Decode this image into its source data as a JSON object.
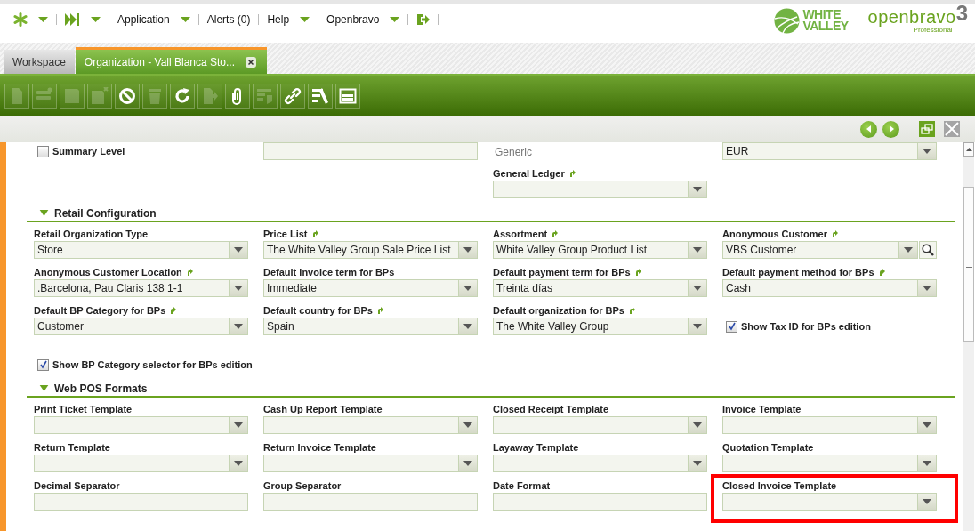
{
  "menu": [
    {
      "kind": "star",
      "caret": true
    },
    {
      "kind": "skip",
      "caret": true
    },
    {
      "kind": "text",
      "label": "Application",
      "caret": true
    },
    {
      "kind": "text",
      "label": "Alerts (0)",
      "caret": false
    },
    {
      "kind": "text",
      "label": "Help",
      "caret": true
    },
    {
      "kind": "text",
      "label": "Openbravo",
      "caret": true
    },
    {
      "kind": "logout",
      "caret": false
    }
  ],
  "logos": {
    "partner_line1": "WHITE",
    "partner_line2": "VALLEY",
    "product": "openbravo",
    "edition": "Professional",
    "version": "3"
  },
  "tabs": [
    {
      "label": "Workspace",
      "selected": false,
      "closable": false
    },
    {
      "label": "Organization - Vall Blanca Sto...",
      "selected": true,
      "closable": true
    }
  ],
  "toolbar": [
    {
      "kind": "new-document",
      "disabled": true
    },
    {
      "kind": "new-row",
      "disabled": true
    },
    {
      "kind": "save",
      "disabled": true
    },
    {
      "kind": "save-close",
      "disabled": true
    },
    {
      "kind": "undo",
      "disabled": false
    },
    {
      "kind": "delete",
      "disabled": true
    },
    {
      "kind": "refresh",
      "disabled": false
    },
    {
      "kind": "export",
      "disabled": true
    },
    {
      "kind": "attach",
      "disabled": false
    },
    {
      "kind": "audit",
      "disabled": true
    },
    {
      "kind": "link",
      "disabled": false
    },
    {
      "kind": "tools",
      "disabled": false
    },
    {
      "kind": "layout",
      "disabled": false
    }
  ],
  "nav": [
    {
      "kind": "previous"
    },
    {
      "kind": "next"
    },
    {
      "kind": "maximize"
    },
    {
      "kind": "close"
    }
  ],
  "top_rows": [
    [
      {
        "kind": "checkbox",
        "label": "Summary Level",
        "checked": false
      },
      {
        "kind": "text"
      },
      {
        "kind": "static",
        "value": "Generic"
      },
      {
        "kind": "select",
        "value": "EUR"
      }
    ],
    [
      null,
      null,
      {
        "kind": "select",
        "label": "General Ledger",
        "link": true
      },
      null
    ]
  ],
  "sections": [
    {
      "title": "Retail Configuration",
      "expanded": true,
      "rows": [
        [
          {
            "kind": "select",
            "label": "Retail Organization Type",
            "value": "Store",
            "link": false
          },
          {
            "kind": "select",
            "label": "Price List",
            "value": "The White Valley Group Sale Price List",
            "link": true
          },
          {
            "kind": "select",
            "label": "Assortment",
            "value": "White Valley Group Product List",
            "link": true
          },
          {
            "kind": "lookup",
            "label": "Anonymous Customer",
            "value": "VBS Customer",
            "link": true
          }
        ],
        [
          {
            "kind": "select",
            "label": "Anonymous Customer Location",
            "value": ".Barcelona, Pau Claris 138 1-1",
            "link": true
          },
          {
            "kind": "select",
            "label": "Default invoice term for BPs",
            "value": "Immediate",
            "link": false
          },
          {
            "kind": "select",
            "label": "Default payment term for BPs",
            "value": "Treinta días",
            "link": true
          },
          {
            "kind": "select",
            "label": "Default payment method for BPs",
            "value": "Cash",
            "link": true
          }
        ],
        [
          {
            "kind": "select",
            "label": "Default BP Category for BPs",
            "value": "Customer",
            "link": true
          },
          {
            "kind": "select",
            "label": "Default country for BPs",
            "value": "Spain",
            "link": true
          },
          {
            "kind": "select",
            "label": "Default organization for BPs",
            "value": "The White Valley Group",
            "link": true
          },
          {
            "kind": "checkbox",
            "label": "Show Tax ID for BPs edition",
            "checked": true
          }
        ],
        [
          {
            "kind": "checkbox",
            "label": "Show BP Category selector for BPs edition",
            "checked": true
          },
          null,
          null,
          null
        ]
      ]
    },
    {
      "title": "Web POS Formats",
      "expanded": true,
      "rows": [
        [
          {
            "kind": "select",
            "label": "Print Ticket Template",
            "link": false
          },
          {
            "kind": "select",
            "label": "Cash Up Report Template",
            "link": false
          },
          {
            "kind": "select",
            "label": "Closed Receipt Template",
            "link": false
          },
          {
            "kind": "select",
            "label": "Invoice Template",
            "link": false
          }
        ],
        [
          {
            "kind": "select",
            "label": "Return Template",
            "link": false
          },
          {
            "kind": "select",
            "label": "Return Invoice Template",
            "link": false
          },
          {
            "kind": "select",
            "label": "Layaway Template",
            "link": false
          },
          {
            "kind": "select",
            "label": "Quotation Template",
            "link": false
          }
        ],
        [
          {
            "kind": "text",
            "label": "Decimal Separator"
          },
          {
            "kind": "text",
            "label": "Group Separator"
          },
          {
            "kind": "text",
            "label": "Date Format"
          },
          {
            "kind": "select",
            "label": "Closed Invoice Template",
            "link": false,
            "highlighted": true
          }
        ]
      ]
    }
  ]
}
